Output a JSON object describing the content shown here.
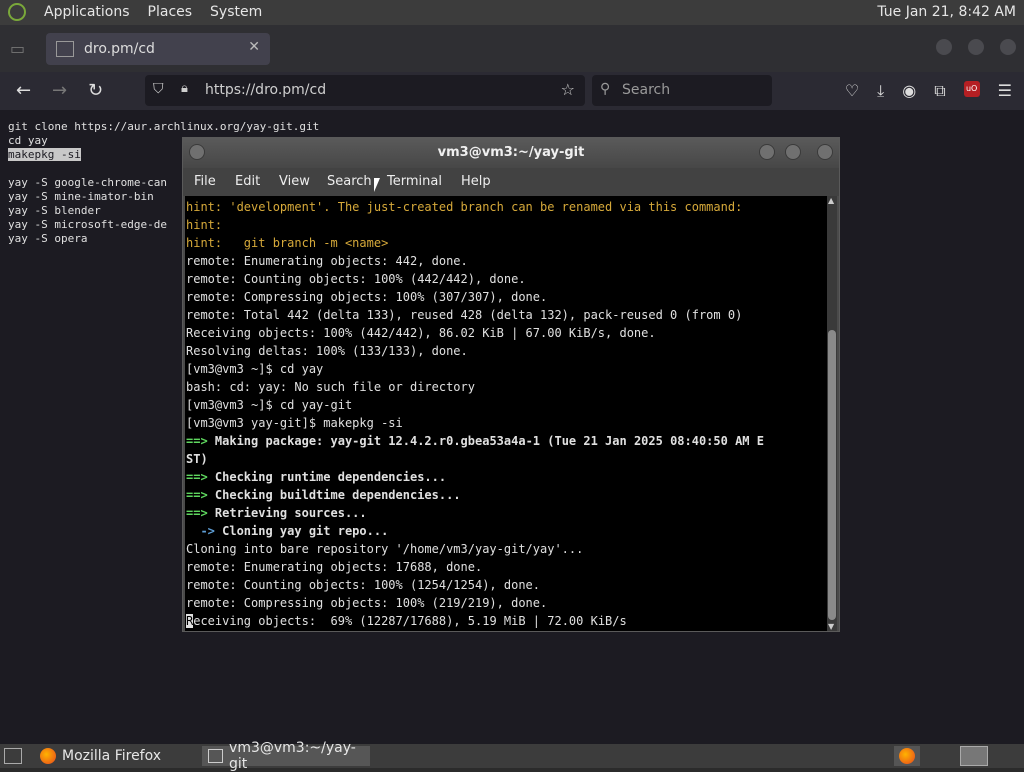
{
  "topbar": {
    "menus": [
      "Applications",
      "Places",
      "System"
    ],
    "clock": "Tue Jan 21,  8:42 AM"
  },
  "browser": {
    "tab_title": "dro.pm/cd",
    "url": "https://dro.pm/cd",
    "search_placeholder": "Search",
    "page_lines": [
      "git clone https://aur.archlinux.org/yay-git.git",
      "cd yay",
      "makepkg -si",
      "",
      "yay -S google-chrome-can",
      "yay -S mine-imator-bin",
      "yay -S blender",
      "yay -S microsoft-edge-de",
      "yay -S opera"
    ]
  },
  "terminal": {
    "title": "vm3@vm3:~/yay-git",
    "menu": [
      "File",
      "Edit",
      "View",
      "Search",
      "Terminal",
      "Help"
    ],
    "lines": {
      "l1": "hint: 'development'. The just-created branch can be renamed via this command:",
      "l2": "hint:",
      "l3": "hint:   git branch -m <name>",
      "l4": "remote: Enumerating objects: 442, done.",
      "l5": "remote: Counting objects: 100% (442/442), done.",
      "l6": "remote: Compressing objects: 100% (307/307), done.",
      "l7": "remote: Total 442 (delta 133), reused 428 (delta 132), pack-reused 0 (from 0)",
      "l8": "Receiving objects: 100% (442/442), 86.02 KiB | 67.00 KiB/s, done.",
      "l9": "Resolving deltas: 100% (133/133), done.",
      "l10": "[vm3@vm3 ~]$ cd yay",
      "l11": "bash: cd: yay: No such file or directory",
      "l12": "[vm3@vm3 ~]$ cd yay-git",
      "l13": "[vm3@vm3 yay-git]$ makepkg -si",
      "l14_arrow": "==>",
      "l14": " Making package: yay-git 12.4.2.r0.gbea53a4a-1 (Tue 21 Jan 2025 08:40:50 AM E",
      "l15": "ST)",
      "l16_arrow": "==>",
      "l16": " Checking runtime dependencies...",
      "l17_arrow": "==>",
      "l17": " Checking buildtime dependencies...",
      "l18_arrow": "==>",
      "l18": " Retrieving sources...",
      "l19_arrow": "  ->",
      "l19": " Cloning yay git repo...",
      "l20": "Cloning into bare repository '/home/vm3/yay-git/yay'...",
      "l21": "remote: Enumerating objects: 17688, done.",
      "l22": "remote: Counting objects: 100% (1254/1254), done.",
      "l23": "remote: Compressing objects: 100% (219/219), done.",
      "l24_first": "R",
      "l24": "eceiving objects:  69% (12287/17688), 5.19 MiB | 72.00 KiB/s"
    }
  },
  "taskbar": {
    "tasks": [
      "Mozilla Firefox",
      "vm3@vm3:~/yay-git"
    ]
  }
}
